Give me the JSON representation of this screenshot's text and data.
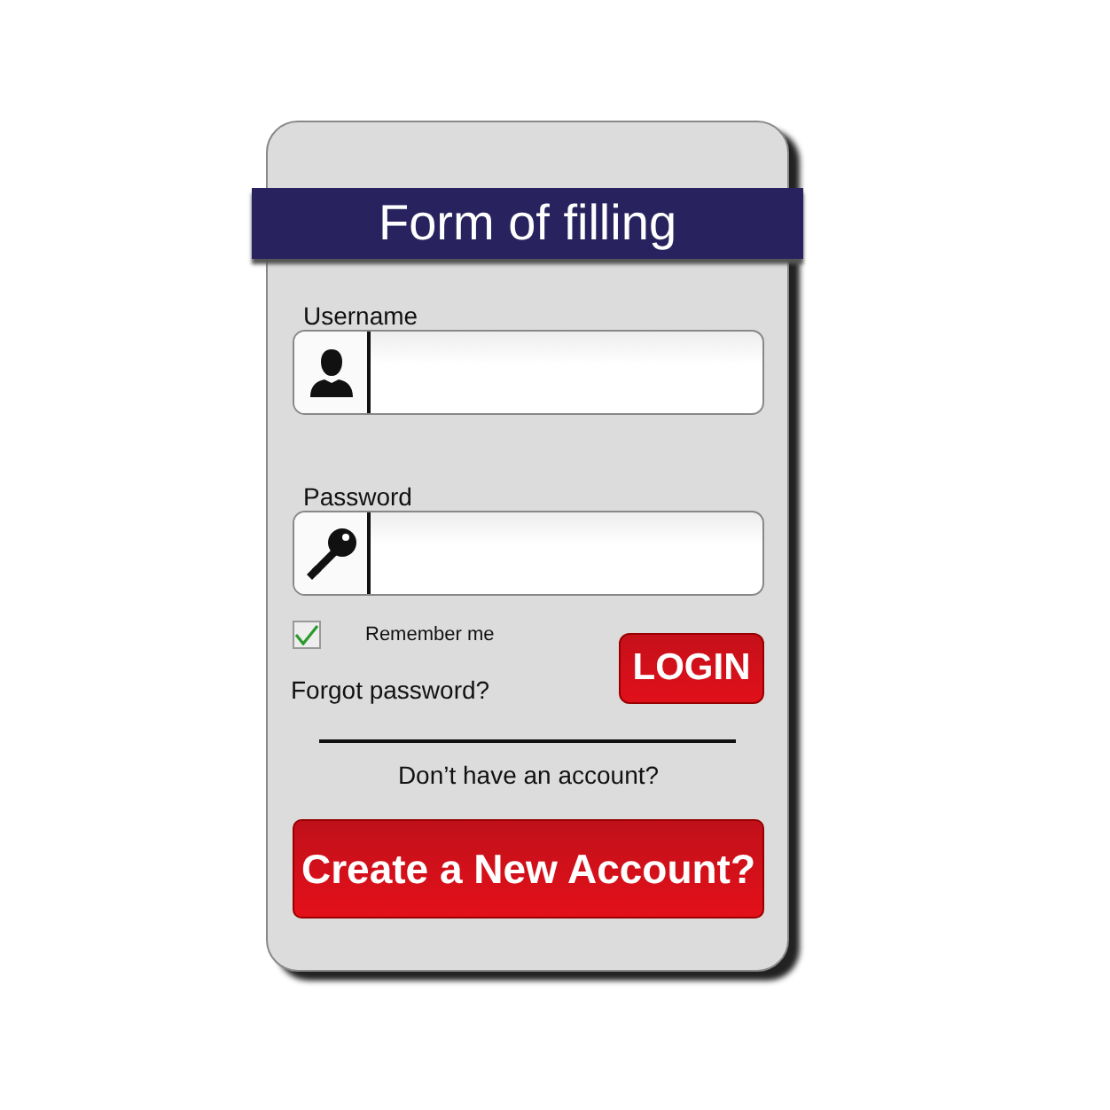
{
  "title": "Form of filling",
  "fields": [
    {
      "label": "Username",
      "kind": "user"
    },
    {
      "label": "Password",
      "kind": "password"
    }
  ],
  "remember": {
    "label": "Remember me",
    "checked": true
  },
  "forgot_link": "Forgot password?",
  "login_button": "LOGIN",
  "signup_prompt": "Don’t have an account?",
  "create_button": "Create a New Account?"
}
